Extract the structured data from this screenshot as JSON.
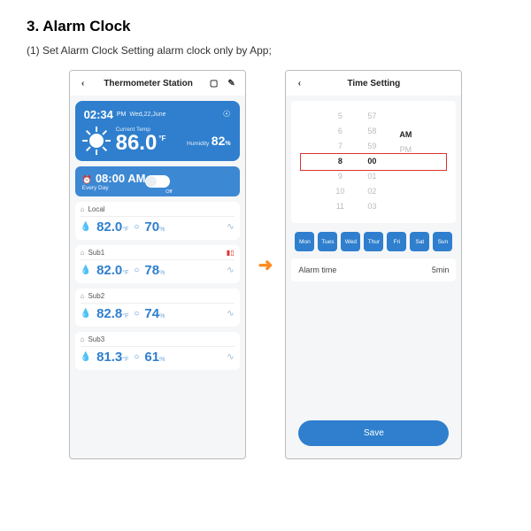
{
  "section": {
    "number": "3.",
    "title": "Alarm Clock",
    "subtitle": "(1) Set Alarm Clock Setting alarm clock only by App;"
  },
  "phone1": {
    "header": {
      "title": "Thermometer Station"
    },
    "hero": {
      "time": "02:34",
      "ampm": "PM",
      "date": "Wed,22,June",
      "temp_label": "Current Temp",
      "temp": "86.0",
      "temp_unit": "°F",
      "hum_label": "Humidity",
      "hum": "82",
      "hum_unit": "%"
    },
    "alarm": {
      "time": "08:00 AM",
      "repeat": "Every Day",
      "toggle_label": "Off"
    },
    "sensors": [
      {
        "name": "Local",
        "temp": "82.0",
        "hum": "70",
        "low_batt": false
      },
      {
        "name": "Sub1",
        "temp": "82.0",
        "hum": "78",
        "low_batt": true
      },
      {
        "name": "Sub2",
        "temp": "82.8",
        "hum": "74",
        "low_batt": false
      },
      {
        "name": "Sub3",
        "temp": "81.3",
        "hum": "61",
        "low_batt": false
      }
    ],
    "unit_f": "°F",
    "unit_pct": "%"
  },
  "phone2": {
    "header": {
      "title": "Time Setting"
    },
    "picker": {
      "hours": [
        "5",
        "6",
        "7",
        "8",
        "9",
        "10",
        "11"
      ],
      "minutes": [
        "57",
        "58",
        "59",
        "00",
        "01",
        "02",
        "03"
      ],
      "ampm": [
        "",
        "",
        "",
        "AM",
        "PM",
        "",
        ""
      ],
      "sel_index": 3
    },
    "days": [
      "Mon",
      "Tues",
      "Wed",
      "Thur",
      "Fri",
      "Sat",
      "Sun"
    ],
    "alarm_time": {
      "label": "Alarm time",
      "value": "5min"
    },
    "save": "Save"
  }
}
